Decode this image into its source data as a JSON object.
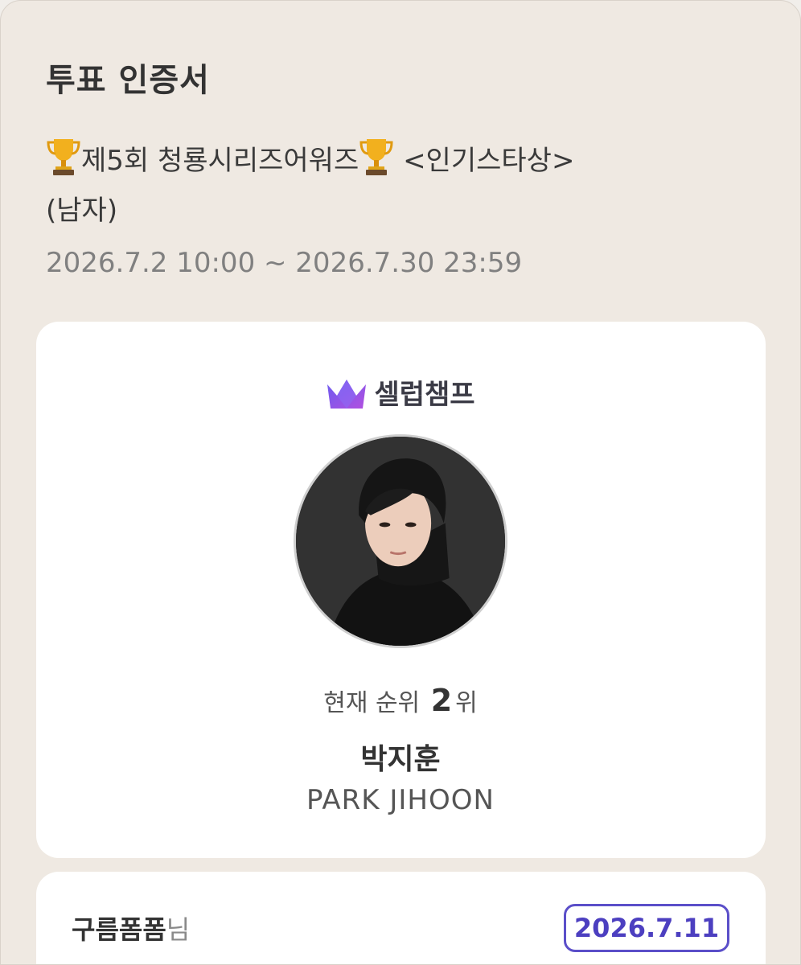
{
  "certificate": {
    "title": "투표 인증서",
    "event_name": "제5회 청룡시리즈어워즈",
    "event_category": "<인기스타상>",
    "event_subcategory": "(남자)",
    "period": "2026.7.2 10:00 ~ 2026.7.30 23:59"
  },
  "brand": {
    "name": "셀럽챔프",
    "logo_icon": "crown-icon"
  },
  "candidate": {
    "rank_label": "현재 순위",
    "rank_value": "2",
    "rank_suffix": "위",
    "name_ko": "박지훈",
    "name_en": "PARK JIHOON"
  },
  "voter": {
    "nickname": "구름폼폼",
    "suffix": "님",
    "date": "2026.7.11"
  },
  "colors": {
    "background": "#efe9e2",
    "card": "#ffffff",
    "accent": "#5b4fc9",
    "period_text": "#808080"
  }
}
